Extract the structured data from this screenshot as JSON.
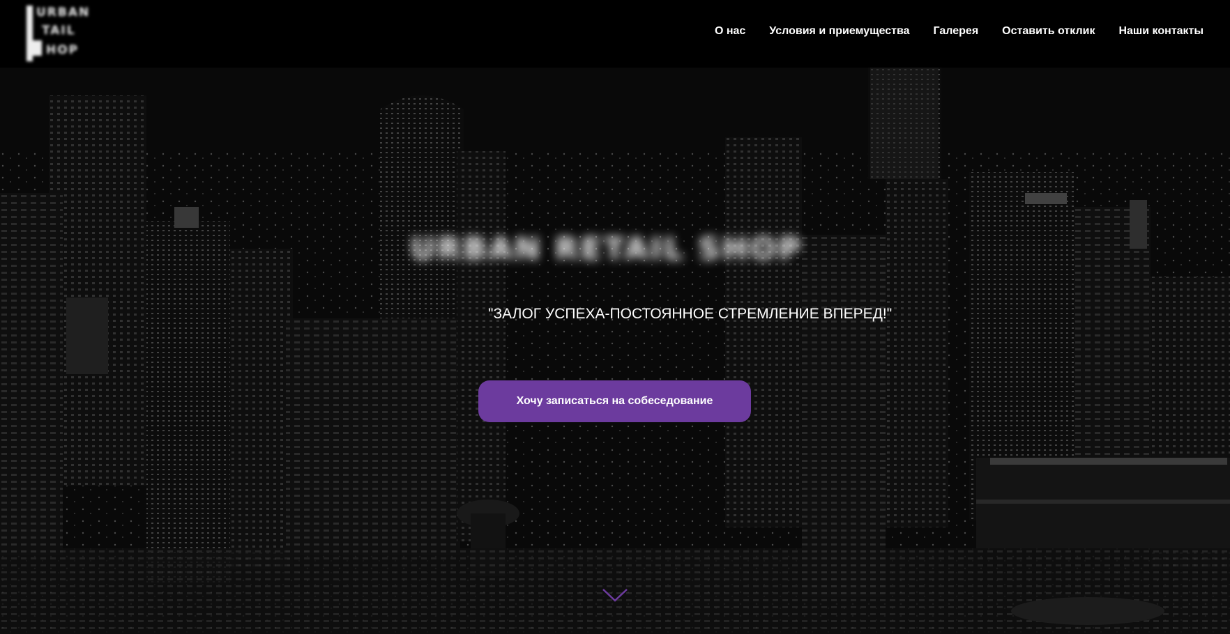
{
  "header": {
    "logo": {
      "lines": [
        "URBAN",
        "TAIL",
        "HOP"
      ]
    },
    "nav": [
      {
        "label": "О нас"
      },
      {
        "label": "Условия и приемущества"
      },
      {
        "label": "Галерея"
      },
      {
        "label": "Оставить отклик"
      },
      {
        "label": "Наши контакты"
      }
    ]
  },
  "hero": {
    "title": "URBAN RETAIL SHOP",
    "slogan": "\"ЗАЛОГ УСПЕХА-ПОСТОЯННОЕ СТРЕМЛЕНИЕ ВПЕРЕД!\"",
    "cta_label": "Хочу записаться на собеседование",
    "scroll_icon": "chevron-down-icon"
  },
  "colors": {
    "accent": "#6c3b9e",
    "header_bg": "#000000",
    "text": "#ffffff"
  }
}
